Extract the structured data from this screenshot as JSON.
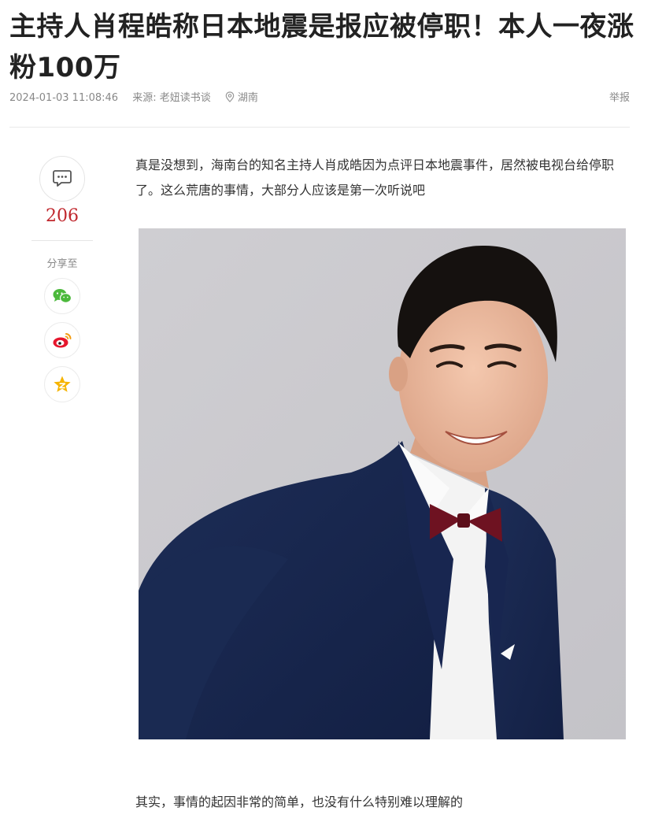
{
  "article": {
    "title": "主持人肖程皓称日本地震是报应被停职！本人一夜涨粉100万",
    "date": "2024-01-03 11:08:46",
    "source": "来源: 老妞读书谈",
    "location": "湖南",
    "report_label": "举报",
    "paragraph1": "真是没想到，海南台的知名主持人肖成皓因为点评日本地震事件，居然被电视台给停职了。这么荒唐的事情，大部分人应该是第一次听说吧",
    "paragraph2": "其实，事情的起因非常的简单，也没有什么特别难以理解的"
  },
  "sidebar": {
    "comment_count": "206",
    "share_label": "分享至",
    "share_targets": [
      "wechat-icon",
      "weibo-icon",
      "qzone-icon"
    ]
  },
  "colors": {
    "accent": "#c0272d",
    "meta_text": "#888888",
    "wechat": "#4cb93c",
    "weibo": "#e6162d",
    "qzone": "#f6b400"
  }
}
